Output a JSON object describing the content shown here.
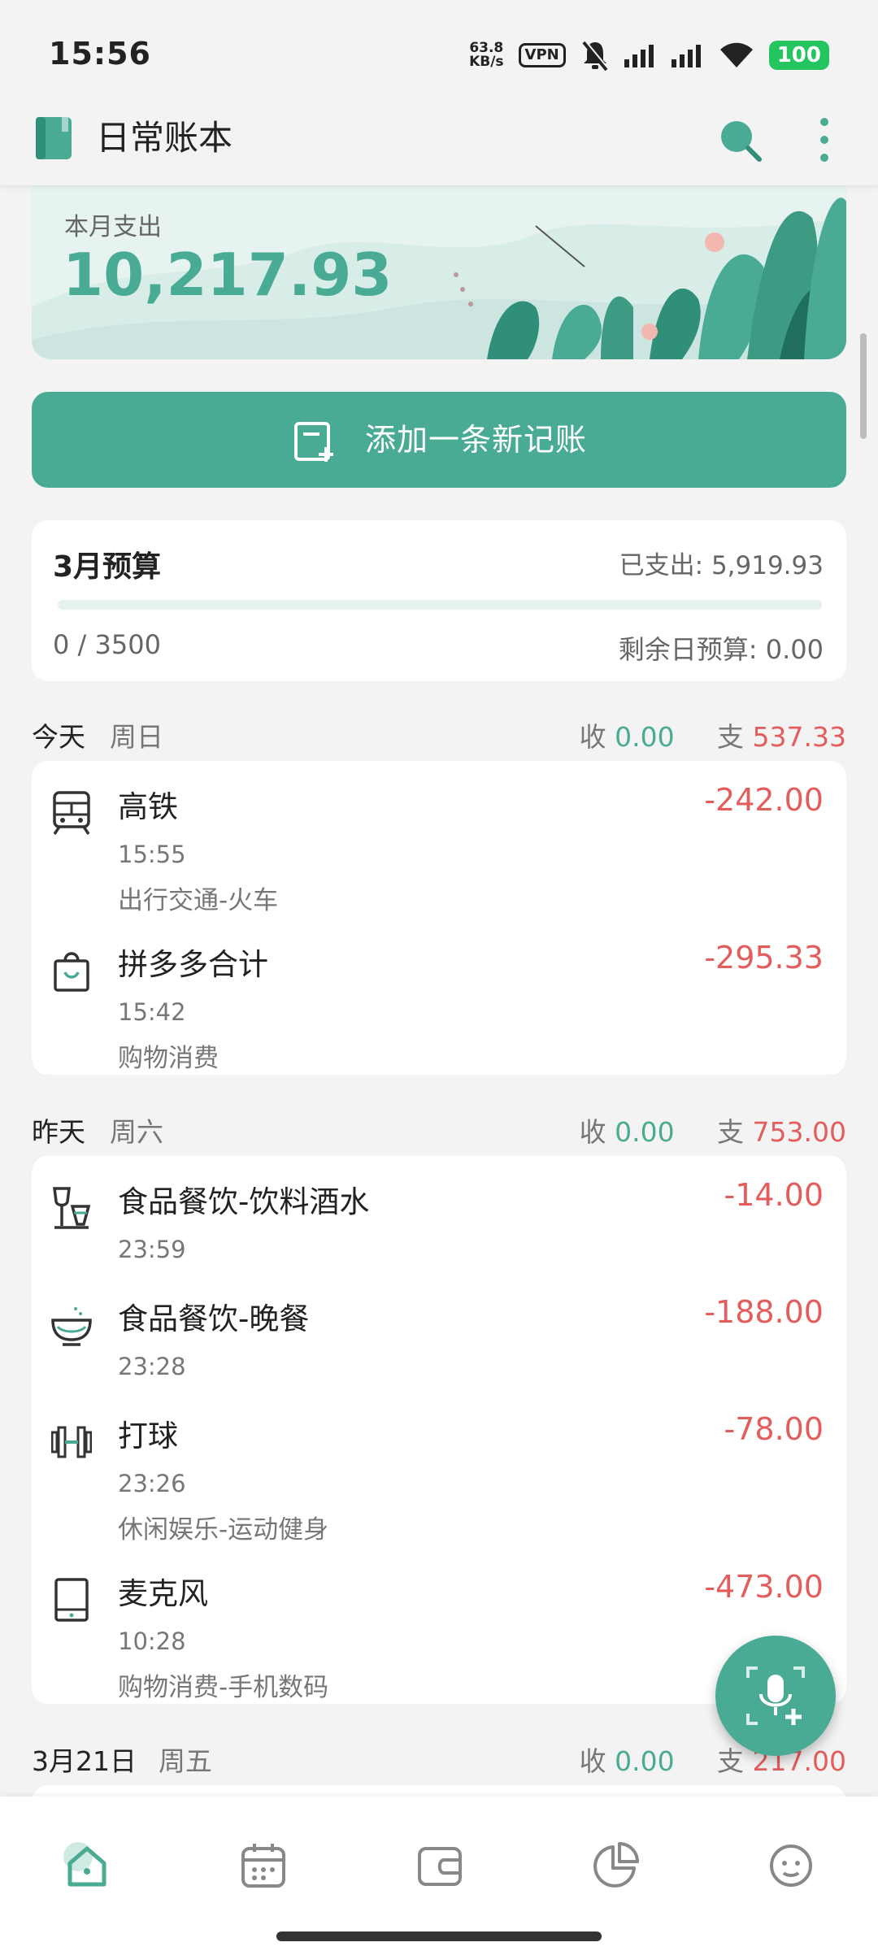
{
  "status": {
    "time": "15:56",
    "net_speed_value": "63.8",
    "net_speed_unit": "KB/s",
    "vpn": "VPN",
    "battery": "100"
  },
  "app": {
    "title": "日常账本"
  },
  "banner": {
    "label": "本月支出",
    "amount": "10,217.93"
  },
  "add_button": {
    "label": "添加一条新记账"
  },
  "budget": {
    "title": "3月预算",
    "spent_label": "已支出: 5,919.93",
    "used": "0 / 3500",
    "remaining_label": "剩余日预算: 0.00",
    "progress_fraction": 0
  },
  "days": [
    {
      "day": "今天",
      "weekday": "周日",
      "income_label": "收",
      "income": "0.00",
      "expense_label": "支",
      "expense": "537.33",
      "items": [
        {
          "title": "高铁",
          "time": "15:55",
          "category": "出行交通-火车",
          "amount": "-242.00",
          "icon": "train-icon"
        },
        {
          "title": "拼多多合计",
          "time": "15:42",
          "category": "购物消费",
          "amount": "-295.33",
          "icon": "shopping-bag-icon"
        }
      ]
    },
    {
      "day": "昨天",
      "weekday": "周六",
      "income_label": "收",
      "income": "0.00",
      "expense_label": "支",
      "expense": "753.00",
      "items": [
        {
          "title": "食品餐饮-饮料酒水",
          "time": "23:59",
          "category": "",
          "amount": "-14.00",
          "icon": "wine-glass-icon"
        },
        {
          "title": "食品餐饮-晚餐",
          "time": "23:28",
          "category": "",
          "amount": "-188.00",
          "icon": "bowl-icon"
        },
        {
          "title": "打球",
          "time": "23:26",
          "category": "休闲娱乐-运动健身",
          "amount": "-78.00",
          "icon": "dumbbell-icon"
        },
        {
          "title": "麦克风",
          "time": "10:28",
          "category": "购物消费-手机数码",
          "amount": "-473.00",
          "icon": "phone-icon"
        }
      ]
    },
    {
      "day": "3月21日",
      "weekday": "周五",
      "income_label": "收",
      "income": "0.00",
      "expense_label": "支",
      "expense": "217.00",
      "items": []
    }
  ],
  "nav": [
    "home-icon",
    "calendar-icon",
    "wallet-icon",
    "chart-pie-icon",
    "profile-icon"
  ],
  "colors": {
    "accent": "#4aab95",
    "expense": "#e35d5d",
    "background": "#f3f3f3"
  }
}
